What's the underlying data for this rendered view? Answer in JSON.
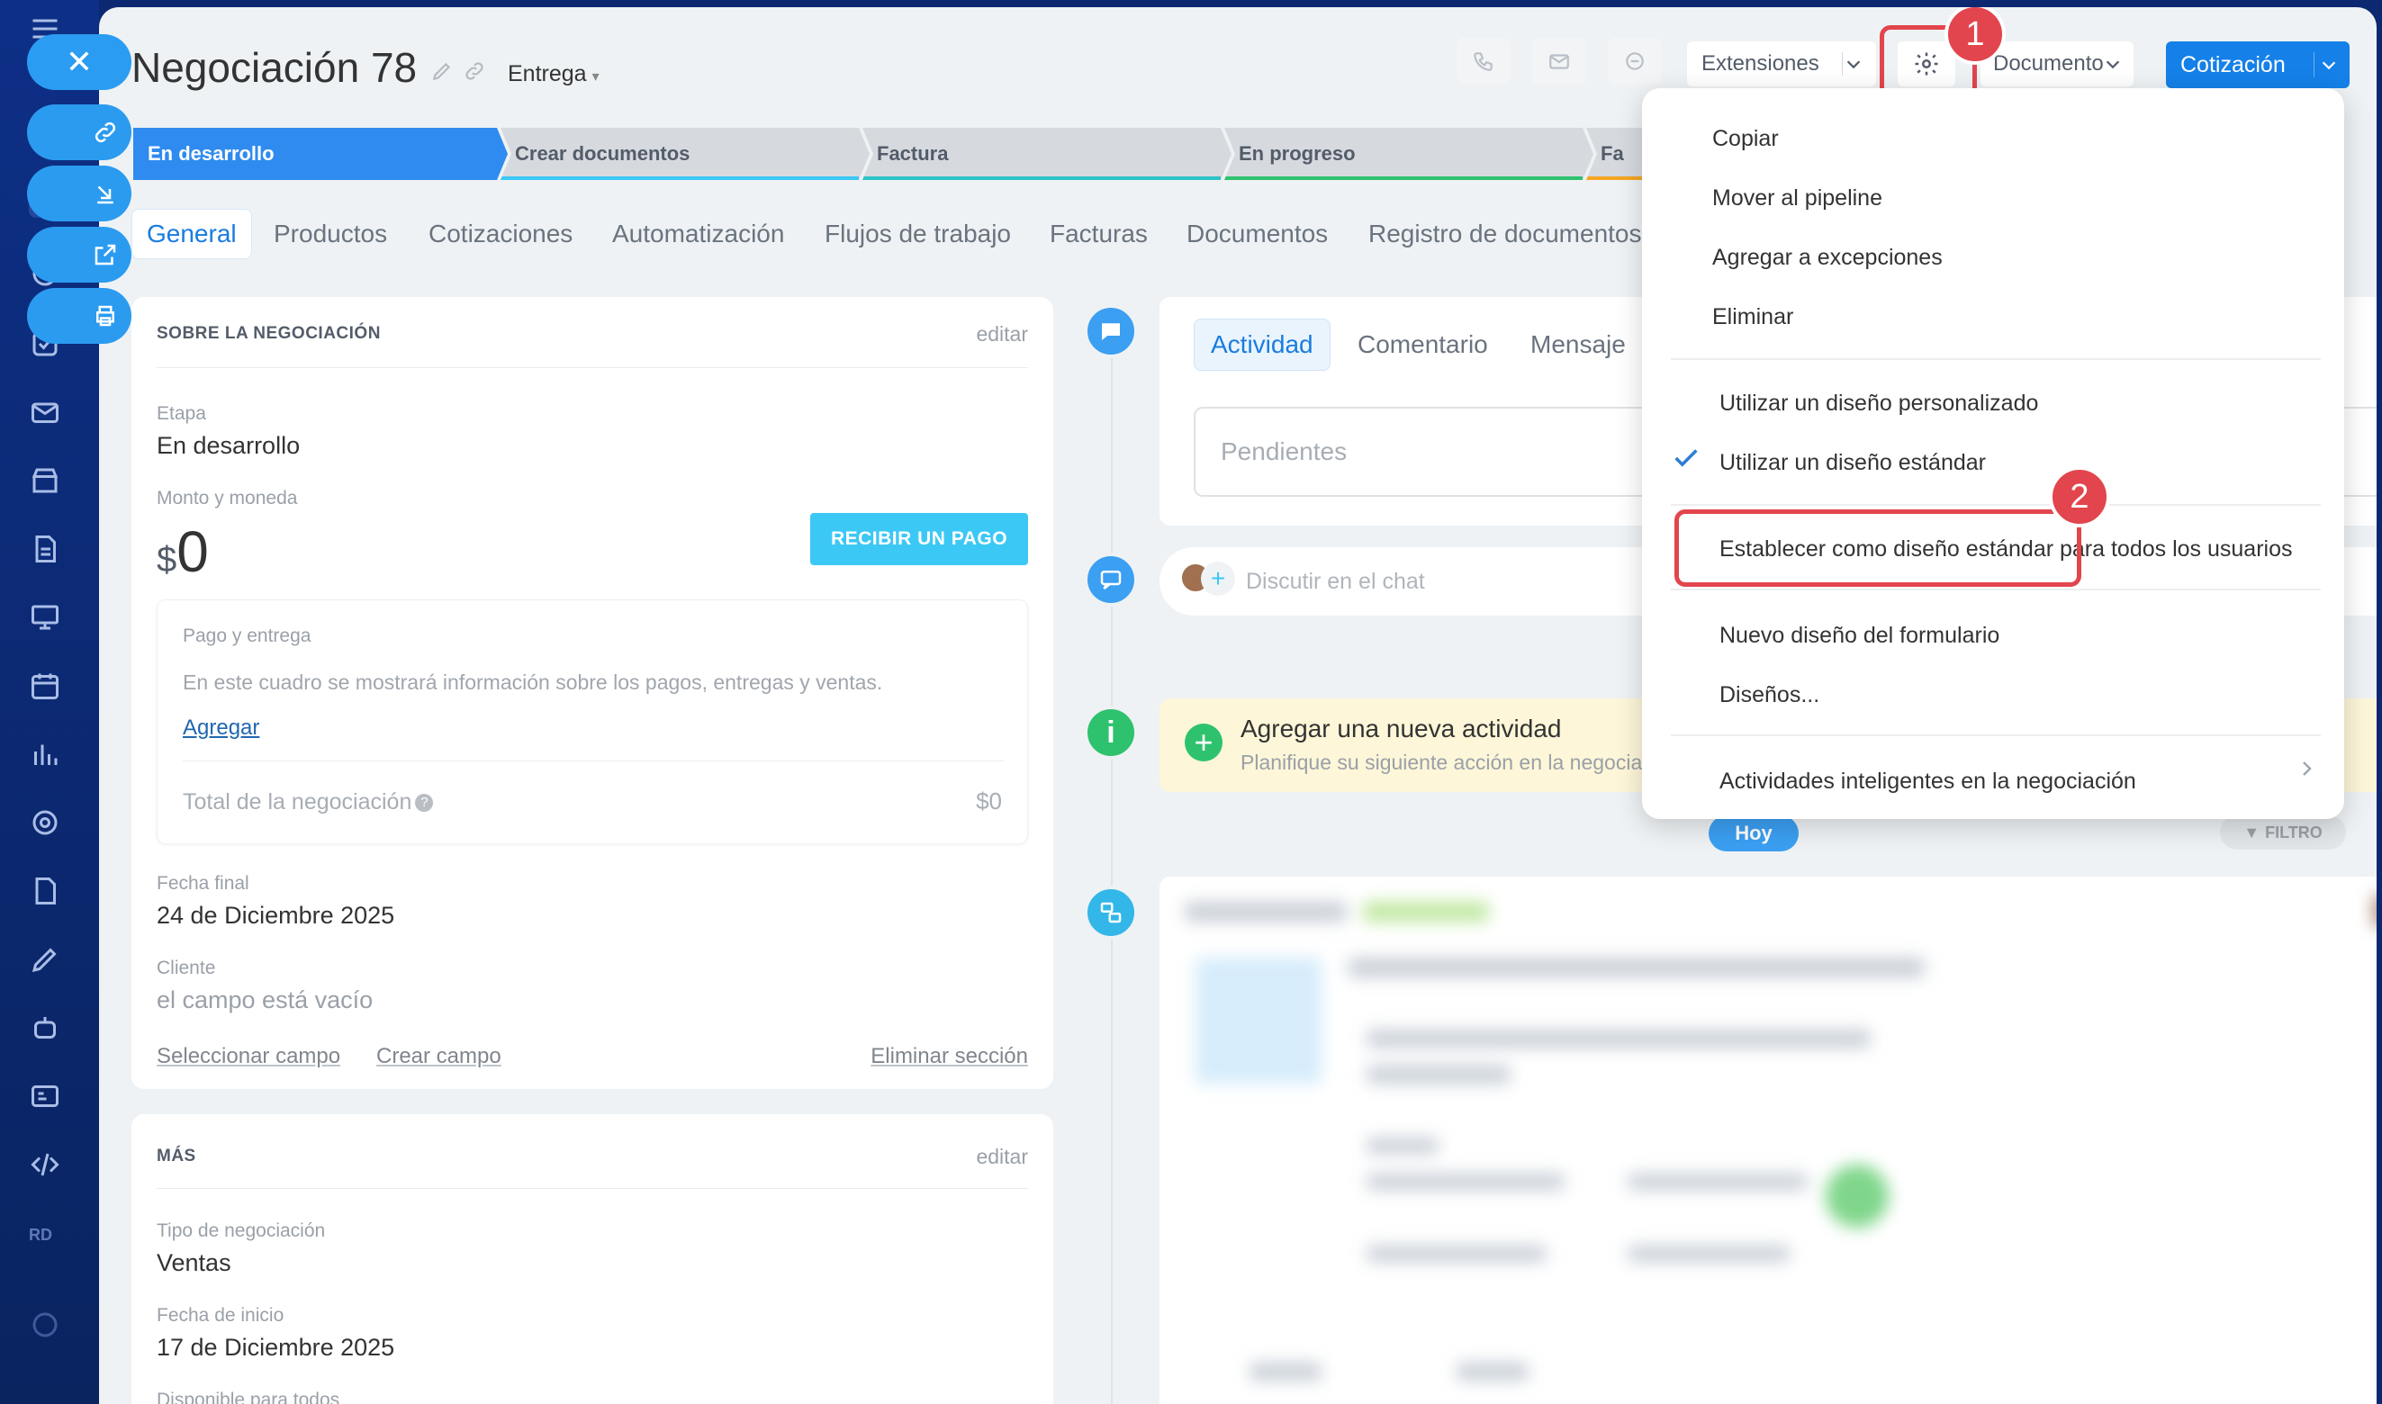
{
  "deal": {
    "title": "Negociación 78",
    "pipeline": "Entrega"
  },
  "header": {
    "extensions_label": "Extensiones",
    "document_label": "Documento",
    "quote_label": "Cotización"
  },
  "stages": [
    {
      "label": "En desarrollo",
      "color": "#2f8bef"
    },
    {
      "label": "Crear documentos",
      "color": "#3bc8f5"
    },
    {
      "label": "Factura",
      "color": "#2ec4c7"
    },
    {
      "label": "En progreso",
      "color": "#2fc26e"
    },
    {
      "label": "Fa",
      "color": "#f5a623"
    }
  ],
  "tabs": [
    "General",
    "Productos",
    "Cotizaciones",
    "Automatización",
    "Flujos de trabajo",
    "Facturas",
    "Documentos",
    "Registro de documentos"
  ],
  "about": {
    "title": "SOBRE LA NEGOCIACIÓN",
    "edit": "editar",
    "stage_label": "Etapa",
    "stage_value": "En desarrollo",
    "amount_label": "Monto y moneda",
    "currency_symbol": "$",
    "amount_value": "0",
    "pay_button": "RECIBIR UN PAGO",
    "payment": {
      "title": "Pago y entrega",
      "description": "En este cuadro se mostrará información sobre los pagos, entregas y ventas.",
      "add": "Agregar",
      "total_label": "Total de la negociación",
      "total_value": "$0"
    },
    "close_date_label": "Fecha final",
    "close_date_value": "24 de Diciembre 2025",
    "client_label": "Cliente",
    "client_value": "el campo está vacío",
    "select_field": "Seleccionar campo",
    "create_field": "Crear campo",
    "delete_section": "Eliminar sección"
  },
  "more": {
    "title": "MÁS",
    "edit": "editar",
    "type_label": "Tipo de negociación",
    "type_value": "Ventas",
    "start_label": "Fecha de inicio",
    "start_value": "17 de Diciembre 2025",
    "available_label": "Disponible para todos"
  },
  "activity": {
    "tabs": [
      "Actividad",
      "Comentario",
      "Mensaje"
    ],
    "pending_placeholder": "Pendientes",
    "chat_placeholder": "Discutir en el chat",
    "new_title": "Agregar una nueva actividad",
    "new_subtitle": "Planifique su siguiente acción en la negociación",
    "today": "Hoy",
    "filter": "FILTRO"
  },
  "menu": {
    "items_top": [
      "Copiar",
      "Mover al pipeline",
      "Agregar a excepciones",
      "Eliminar"
    ],
    "custom_design": "Utilizar un diseño personalizado",
    "standard_design": "Utilizar un diseño estándar",
    "set_standard": "Establecer como diseño estándar para todos los usuarios",
    "new_form": "Nuevo diseño del formulario",
    "designs": "Diseños...",
    "smart": "Actividades inteligentes en la negociación"
  },
  "callouts": [
    "1",
    "2"
  ],
  "sidebar": {
    "user_initials": "RD"
  },
  "colors": {
    "accent": "#1580e8",
    "highlight": "#e2454d",
    "panel": "#eef2f4"
  }
}
